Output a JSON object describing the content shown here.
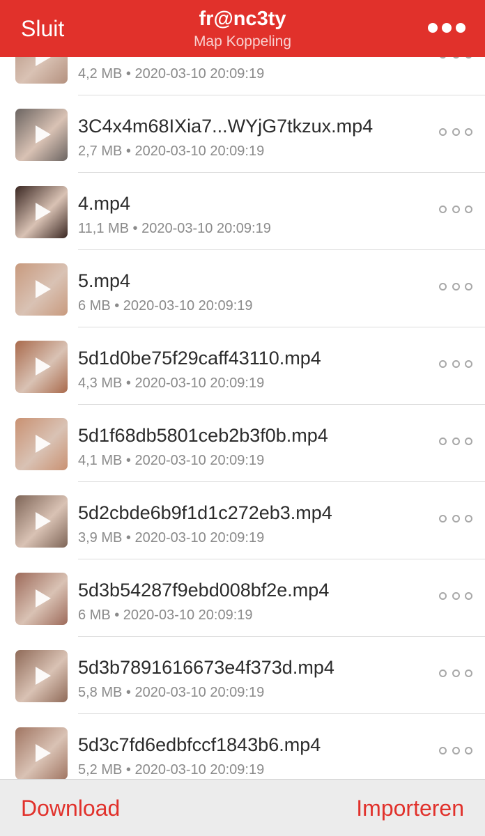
{
  "header": {
    "close_label": "Sluit",
    "title": "fr@nc3ty",
    "subtitle": "Map Koppeling",
    "menu_icon": "more-horizontal-icon"
  },
  "colors": {
    "brand_red": "#e1312b",
    "text_dark": "#2b2b2b",
    "text_meta": "#8a8a8a",
    "footer_bg": "#ececec"
  },
  "files": [
    {
      "name": "",
      "meta": "4,2 MB • 2020-03-10 20:09:19",
      "thumb": "#b4917f"
    },
    {
      "name": "3C4x4m68IXia7...WYjG7tkzux.mp4",
      "meta": "2,7 MB • 2020-03-10 20:09:19",
      "thumb": "#6b6461"
    },
    {
      "name": "4.mp4",
      "meta": "11,1 MB • 2020-03-10 20:09:19",
      "thumb": "#3a2722"
    },
    {
      "name": "5.mp4",
      "meta": "6 MB • 2020-03-10 20:09:19",
      "thumb": "#c89a7e"
    },
    {
      "name": "5d1d0be75f29caff43110.mp4",
      "meta": "4,3 MB • 2020-03-10 20:09:19",
      "thumb": "#a96a4c"
    },
    {
      "name": "5d1f68db5801ceb2b3f0b.mp4",
      "meta": "4,1 MB • 2020-03-10 20:09:19",
      "thumb": "#c99172"
    },
    {
      "name": "5d2cbde6b9f1d1c272eb3.mp4",
      "meta": "3,9 MB • 2020-03-10 20:09:19",
      "thumb": "#7e6557"
    },
    {
      "name": "5d3b54287f9ebd008bf2e.mp4",
      "meta": "6 MB • 2020-03-10 20:09:19",
      "thumb": "#9d6a5a"
    },
    {
      "name": "5d3b7891616673e4f373d.mp4",
      "meta": "5,8 MB • 2020-03-10 20:09:19",
      "thumb": "#8f6a58"
    },
    {
      "name": "5d3c7fd6edbfccf1843b6.mp4",
      "meta": "5,2 MB • 2020-03-10 20:09:19",
      "thumb": "#a07562"
    }
  ],
  "footer": {
    "download_label": "Download",
    "import_label": "Importeren"
  }
}
